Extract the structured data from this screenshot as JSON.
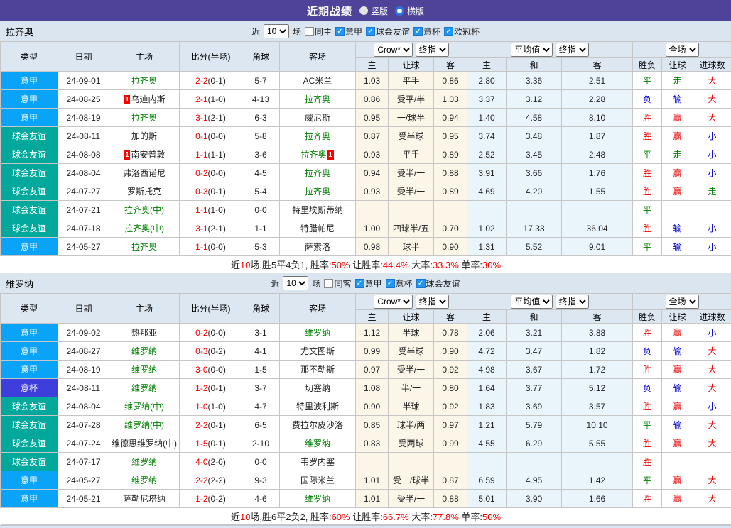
{
  "title_bar": {
    "title": "近期战绩",
    "vertical_label": "竖版",
    "horizontal_label": "横版"
  },
  "table_header": {
    "cols": [
      "类型",
      "日期",
      "主场",
      "比分(半场)",
      "角球",
      "客场"
    ],
    "book_select": "Crow*",
    "final_select": "终指",
    "avg_select": "平均值",
    "final_select2": "终指",
    "scope_select": "全场",
    "odds_group_cols": [
      "主",
      "让球",
      "客"
    ],
    "avg_group_cols": [
      "主",
      "和",
      "客"
    ],
    "result_group_cols": [
      "胜负",
      "让球",
      "进球数"
    ]
  },
  "colors": {
    "topbar_purple": "#4e4398",
    "seriea_blue": "#09a3f7",
    "friendly_teal": "#02a89c",
    "coppa_indigo": "#3e3edd",
    "focus_team_green": "#008000",
    "win_red": "#ee0000",
    "lose_blue": "#0000cc",
    "odds_col_bg": "#fcf6e9",
    "avg_col_bg": "#e9f4fb",
    "bar_bg": "#dbe5f0"
  },
  "sections": [
    {
      "team": "拉齐奥",
      "filter": {
        "near_label": "近",
        "count": "10",
        "unit_label": "场",
        "same_label": "同主",
        "leagues": [
          "意甲",
          "球会友谊",
          "意杯",
          "欧冠杯"
        ]
      },
      "rows": [
        {
          "type": "意甲",
          "league": "seriea",
          "date": "24-09-01",
          "home": {
            "name": "拉齐奥",
            "green": true
          },
          "score": "2-2",
          "half": "(0-1)",
          "corner": "5-7",
          "away": {
            "name": "AC米兰"
          },
          "odds": [
            "1.03",
            "平手",
            "0.86"
          ],
          "avg": [
            "2.80",
            "3.36",
            "2.51"
          ],
          "result": [
            "平",
            "走",
            "大"
          ]
        },
        {
          "type": "意甲",
          "league": "seriea",
          "date": "24-08-25",
          "home": {
            "name": "乌迪内斯",
            "b": "1"
          },
          "score": "2-1",
          "half": "(1-0)",
          "corner": "4-13",
          "away": {
            "name": "拉齐奥",
            "green": true
          },
          "odds": [
            "0.86",
            "受平/半",
            "1.03"
          ],
          "avg": [
            "3.37",
            "3.12",
            "2.28"
          ],
          "result": [
            "负",
            "输",
            "大"
          ]
        },
        {
          "type": "意甲",
          "league": "seriea",
          "date": "24-08-19",
          "home": {
            "name": "拉齐奥",
            "green": true
          },
          "score": "3-1",
          "half": "(2-1)",
          "corner": "6-3",
          "away": {
            "name": "威尼斯"
          },
          "odds": [
            "0.95",
            "一/球半",
            "0.94"
          ],
          "avg": [
            "1.40",
            "4.58",
            "8.10"
          ],
          "result": [
            "胜",
            "赢",
            "大"
          ]
        },
        {
          "type": "球会友谊",
          "league": "friendly",
          "date": "24-08-11",
          "home": {
            "name": "加的斯"
          },
          "score": "0-1",
          "half": "(0-0)",
          "corner": "5-8",
          "away": {
            "name": "拉齐奥",
            "green": true
          },
          "odds": [
            "0.87",
            "受半球",
            "0.95"
          ],
          "avg": [
            "3.74",
            "3.48",
            "1.87"
          ],
          "result": [
            "胜",
            "赢",
            "小"
          ]
        },
        {
          "type": "球会友谊",
          "league": "friendly",
          "date": "24-08-08",
          "home": {
            "name": "南安普敦",
            "b": "1"
          },
          "score": "1-1",
          "half": "(1-1)",
          "corner": "3-6",
          "away": {
            "name": "拉齐奥",
            "green": true,
            "a": "1"
          },
          "odds": [
            "0.93",
            "平手",
            "0.89"
          ],
          "avg": [
            "2.52",
            "3.45",
            "2.48"
          ],
          "result": [
            "平",
            "走",
            "小"
          ]
        },
        {
          "type": "球会友谊",
          "league": "friendly",
          "date": "24-08-04",
          "home": {
            "name": "弗洛西诺尼"
          },
          "score": "0-2",
          "half": "(0-0)",
          "corner": "4-5",
          "away": {
            "name": "拉齐奥",
            "green": true
          },
          "odds": [
            "0.94",
            "受半/一",
            "0.88"
          ],
          "avg": [
            "3.91",
            "3.66",
            "1.76"
          ],
          "result": [
            "胜",
            "赢",
            "小"
          ]
        },
        {
          "type": "球会友谊",
          "league": "friendly",
          "date": "24-07-27",
          "home": {
            "name": "罗斯托克"
          },
          "score": "0-3",
          "half": "(0-1)",
          "corner": "5-4",
          "away": {
            "name": "拉齐奥",
            "green": true
          },
          "odds": [
            "0.93",
            "受半/一",
            "0.89"
          ],
          "avg": [
            "4.69",
            "4.20",
            "1.55"
          ],
          "result": [
            "胜",
            "赢",
            "走"
          ]
        },
        {
          "type": "球会友谊",
          "league": "friendly",
          "date": "24-07-21",
          "home": {
            "name": "拉齐奥(中)",
            "green": true
          },
          "score": "1-1",
          "half": "(1-0)",
          "corner": "0-0",
          "away": {
            "name": "特里埃斯蒂纳"
          },
          "odds": [
            "",
            "",
            ""
          ],
          "avg": [
            "",
            "",
            ""
          ],
          "result": [
            "平",
            "",
            ""
          ]
        },
        {
          "type": "球会友谊",
          "league": "friendly",
          "date": "24-07-18",
          "home": {
            "name": "拉齐奥(中)",
            "green": true
          },
          "score": "3-1",
          "half": "(2-1)",
          "corner": "1-1",
          "away": {
            "name": "特腊帕尼"
          },
          "odds": [
            "1.00",
            "四球半/五",
            "0.70"
          ],
          "avg": [
            "1.02",
            "17.33",
            "36.04"
          ],
          "result": [
            "胜",
            "输",
            "小"
          ]
        },
        {
          "type": "意甲",
          "league": "seriea",
          "date": "24-05-27",
          "home": {
            "name": "拉齐奥",
            "green": true
          },
          "score": "1-1",
          "half": "(0-0)",
          "corner": "5-3",
          "away": {
            "name": "萨索洛"
          },
          "odds": [
            "0.98",
            "球半",
            "0.90"
          ],
          "avg": [
            "1.31",
            "5.52",
            "9.01"
          ],
          "result": [
            "平",
            "输",
            "小"
          ]
        }
      ],
      "summary_parts": [
        "近",
        "10",
        "场,胜5平4负1, 胜率:",
        "50%",
        " 让胜率:",
        "44.4%",
        " 大率:",
        "33.3%",
        " 单率:",
        "30%"
      ]
    },
    {
      "team": "维罗纳",
      "filter": {
        "near_label": "近",
        "count": "10",
        "unit_label": "场",
        "same_label": "同客",
        "leagues": [
          "意甲",
          "意杯",
          "球会友谊"
        ]
      },
      "rows": [
        {
          "type": "意甲",
          "league": "seriea",
          "date": "24-09-02",
          "home": {
            "name": "热那亚"
          },
          "score": "0-2",
          "half": "(0-0)",
          "corner": "3-1",
          "away": {
            "name": "维罗纳",
            "green": true
          },
          "odds": [
            "1.12",
            "半球",
            "0.78"
          ],
          "avg": [
            "2.06",
            "3.21",
            "3.88"
          ],
          "result": [
            "胜",
            "赢",
            "小"
          ]
        },
        {
          "type": "意甲",
          "league": "seriea",
          "date": "24-08-27",
          "home": {
            "name": "维罗纳",
            "green": true
          },
          "score": "0-3",
          "half": "(0-2)",
          "corner": "4-1",
          "away": {
            "name": "尤文图斯"
          },
          "odds": [
            "0.99",
            "受半球",
            "0.90"
          ],
          "avg": [
            "4.72",
            "3.47",
            "1.82"
          ],
          "result": [
            "负",
            "输",
            "大"
          ]
        },
        {
          "type": "意甲",
          "league": "seriea",
          "date": "24-08-19",
          "home": {
            "name": "维罗纳",
            "green": true
          },
          "score": "3-0",
          "half": "(0-0)",
          "corner": "1-5",
          "away": {
            "name": "那不勒斯"
          },
          "odds": [
            "0.97",
            "受半/一",
            "0.92"
          ],
          "avg": [
            "4.98",
            "3.67",
            "1.72"
          ],
          "result": [
            "胜",
            "赢",
            "大"
          ]
        },
        {
          "type": "意杯",
          "league": "coppa",
          "date": "24-08-11",
          "home": {
            "name": "维罗纳",
            "green": true
          },
          "score": "1-2",
          "half": "(0-1)",
          "corner": "3-7",
          "away": {
            "name": "切塞纳"
          },
          "odds": [
            "1.08",
            "半/一",
            "0.80"
          ],
          "avg": [
            "1.64",
            "3.77",
            "5.12"
          ],
          "result": [
            "负",
            "输",
            "大"
          ]
        },
        {
          "type": "球会友谊",
          "league": "friendly",
          "date": "24-08-04",
          "home": {
            "name": "维罗纳(中)",
            "green": true
          },
          "score": "1-0",
          "half": "(1-0)",
          "corner": "4-7",
          "away": {
            "name": "特里波利斯"
          },
          "odds": [
            "0.90",
            "半球",
            "0.92"
          ],
          "avg": [
            "1.83",
            "3.69",
            "3.57"
          ],
          "result": [
            "胜",
            "赢",
            "小"
          ]
        },
        {
          "type": "球会友谊",
          "league": "friendly",
          "date": "24-07-28",
          "home": {
            "name": "维罗纳(中)",
            "green": true
          },
          "score": "2-2",
          "half": "(0-1)",
          "corner": "6-5",
          "away": {
            "name": "费拉尔皮沙洛"
          },
          "odds": [
            "0.85",
            "球半/两",
            "0.97"
          ],
          "avg": [
            "1.21",
            "5.79",
            "10.10"
          ],
          "result": [
            "平",
            "输",
            "大"
          ]
        },
        {
          "type": "球会友谊",
          "league": "friendly",
          "date": "24-07-24",
          "home": {
            "name": "维德思维罗纳(中)"
          },
          "score": "1-5",
          "half": "(0-1)",
          "corner": "2-10",
          "away": {
            "name": "维罗纳",
            "green": true
          },
          "odds": [
            "0.83",
            "受两球",
            "0.99"
          ],
          "avg": [
            "4.55",
            "6.29",
            "5.55"
          ],
          "result": [
            "胜",
            "赢",
            "大"
          ]
        },
        {
          "type": "球会友谊",
          "league": "friendly",
          "date": "24-07-17",
          "home": {
            "name": "维罗纳",
            "green": true
          },
          "score": "4-0",
          "half": "(2-0)",
          "corner": "0-0",
          "away": {
            "name": "韦罗内塞"
          },
          "odds": [
            "",
            "",
            ""
          ],
          "avg": [
            "",
            "",
            ""
          ],
          "result": [
            "胜",
            "",
            ""
          ]
        },
        {
          "type": "意甲",
          "league": "seriea",
          "date": "24-05-27",
          "home": {
            "name": "维罗纳",
            "green": true
          },
          "score": "2-2",
          "half": "(2-2)",
          "corner": "9-3",
          "away": {
            "name": "国际米兰"
          },
          "odds": [
            "1.01",
            "受一/球半",
            "0.87"
          ],
          "avg": [
            "6.59",
            "4.95",
            "1.42"
          ],
          "result": [
            "平",
            "赢",
            "大"
          ]
        },
        {
          "type": "意甲",
          "league": "seriea",
          "date": "24-05-21",
          "home": {
            "name": "萨勒尼塔纳"
          },
          "score": "1-2",
          "half": "(0-2)",
          "corner": "4-6",
          "away": {
            "name": "维罗纳",
            "green": true
          },
          "odds": [
            "1.01",
            "受半/一",
            "0.88"
          ],
          "avg": [
            "5.01",
            "3.90",
            "1.66"
          ],
          "result": [
            "胜",
            "赢",
            "大"
          ]
        }
      ],
      "summary_parts": [
        "近",
        "10",
        "场,胜6平2负2, 胜率:",
        "60%",
        " 让胜率:",
        "66.7%",
        " 大率:",
        "77.8%",
        " 单率:",
        "50%"
      ]
    }
  ]
}
